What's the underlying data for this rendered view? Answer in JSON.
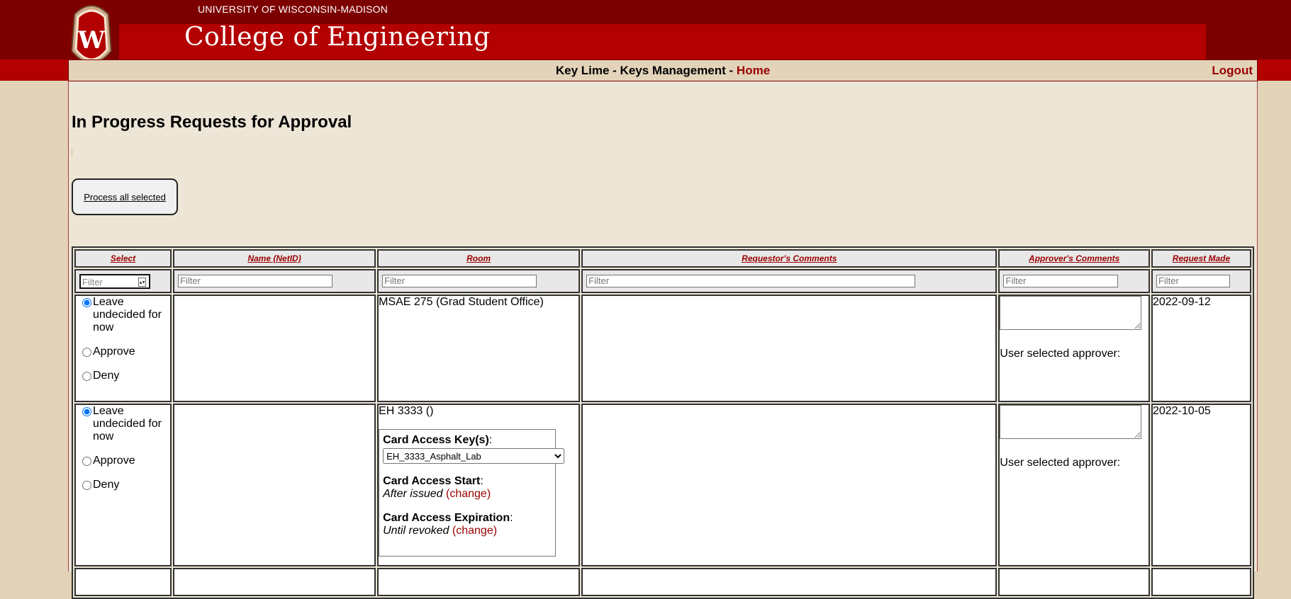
{
  "header": {
    "university": "UNIVERSITY OF WISCONSIN-MADISON",
    "college": "College of Engineering",
    "logo_letter": "W"
  },
  "nav": {
    "app_title": "Key Lime - Keys Management - ",
    "home": "Home",
    "logout": "Logout"
  },
  "page": {
    "title": "In Progress Requests for Approval",
    "process_button": "Process all selected"
  },
  "table": {
    "headers": {
      "select": "Select",
      "name": "Name (NetID)",
      "room": "Room",
      "requestor_comments": "Requestor's Comments",
      "approver_comments": "Approver's Comments",
      "request_made": "Request Made"
    },
    "filter_placeholder": "Filter",
    "options": {
      "leave": "Leave undecided for now",
      "approve": "Approve",
      "deny": "Deny"
    },
    "user_selected_approver": "User selected approver:",
    "rows": [
      {
        "name": "",
        "room": "MSAE 275 (Grad Student Office)",
        "requestor_comments": "",
        "request_made": "2022-09-12"
      },
      {
        "name": "",
        "room": "EH 3333 ()",
        "requestor_comments": "",
        "request_made": "2022-10-05",
        "card": {
          "keys_label": "Card Access Key(s)",
          "keys_selected": "EH_3333_Asphalt_Lab",
          "start_label": "Card Access Start",
          "start_value": "After issued",
          "expiration_label": "Card Access Expiration",
          "expiration_value": "Until revoked",
          "change": "(change)"
        }
      }
    ]
  },
  "colors": {
    "dark_red": "#7d0000",
    "red": "#b30000",
    "link_red": "#990000",
    "tan": "#e2d3b9",
    "cream": "#ede5d6"
  }
}
